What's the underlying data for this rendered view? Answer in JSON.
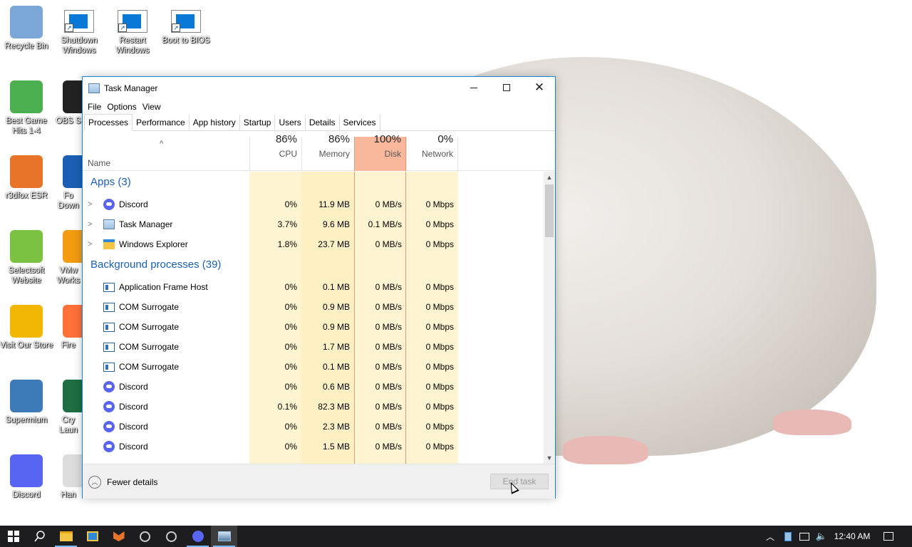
{
  "desktop": {
    "icons_col1": [
      {
        "label": "Recycle Bin",
        "icon": "recycle-bin-icon",
        "color": "#7aa6d8"
      },
      {
        "label": "Best Game Hits 1-4",
        "icon": "dice-icon",
        "color": "#4caf50"
      },
      {
        "label": "r3dfox ESR",
        "icon": "fox-browser-icon",
        "color": "#e8742a"
      },
      {
        "label": "Selectsoft Website",
        "icon": "selectsoft-icon",
        "color": "#7cc242"
      },
      {
        "label": "Visit Our Store",
        "icon": "store-icon",
        "color": "#f2b705"
      },
      {
        "label": "Supermium",
        "icon": "supermium-icon",
        "color": "#3d7ab8"
      },
      {
        "label": "Discord",
        "icon": "discord-icon",
        "color": "#5865f2"
      }
    ],
    "icons_col2_partial": [
      {
        "label": "OBS S",
        "icon": "obs-icon",
        "color": "#222222"
      },
      {
        "label": "Fo Down",
        "icon": "download-icon",
        "color": "#1a5fb4"
      },
      {
        "label": "VMw Works",
        "icon": "vmware-icon",
        "color": "#f39c12"
      },
      {
        "label": "Fire",
        "icon": "firefox-icon",
        "color": "#ff7139"
      },
      {
        "label": "Cry Laun",
        "icon": "launcher-icon",
        "color": "#1f6e43"
      },
      {
        "label": "Han",
        "icon": "document-icon",
        "color": "#dddddd"
      }
    ],
    "icons_top": [
      {
        "label": "Shutdown Windows",
        "icon": "shutdown-shortcut-icon"
      },
      {
        "label": "Restart Windows",
        "icon": "restart-shortcut-icon"
      },
      {
        "label": "Boot to BIOS",
        "icon": "bios-shortcut-icon"
      }
    ]
  },
  "window": {
    "title": "Task Manager",
    "menu": [
      "File",
      "Options",
      "View"
    ],
    "tabs": [
      "Processes",
      "Performance",
      "App history",
      "Startup",
      "Users",
      "Details",
      "Services"
    ],
    "active_tab": "Processes",
    "columns": {
      "name": "Name",
      "cpu": {
        "pct": "86%",
        "label": "CPU"
      },
      "memory": {
        "pct": "86%",
        "label": "Memory"
      },
      "disk": {
        "pct": "100%",
        "label": "Disk"
      },
      "network": {
        "pct": "0%",
        "label": "Network"
      }
    },
    "groups": [
      {
        "title": "Apps (3)",
        "rows": [
          {
            "name": "Discord",
            "icon": "discord",
            "expandable": true,
            "cpu": "0%",
            "memory": "11.9 MB",
            "disk": "0 MB/s",
            "network": "0 Mbps"
          },
          {
            "name": "Task Manager",
            "icon": "tm",
            "expandable": true,
            "cpu": "3.7%",
            "memory": "9.6 MB",
            "disk": "0.1 MB/s",
            "network": "0 Mbps"
          },
          {
            "name": "Windows Explorer",
            "icon": "explorer",
            "expandable": true,
            "cpu": "1.8%",
            "memory": "23.7 MB",
            "disk": "0 MB/s",
            "network": "0 Mbps"
          }
        ]
      },
      {
        "title": "Background processes (39)",
        "rows": [
          {
            "name": "Application Frame Host",
            "icon": "window",
            "expandable": false,
            "cpu": "0%",
            "memory": "0.1 MB",
            "disk": "0 MB/s",
            "network": "0 Mbps"
          },
          {
            "name": "COM Surrogate",
            "icon": "window",
            "expandable": false,
            "cpu": "0%",
            "memory": "0.9 MB",
            "disk": "0 MB/s",
            "network": "0 Mbps"
          },
          {
            "name": "COM Surrogate",
            "icon": "window",
            "expandable": false,
            "cpu": "0%",
            "memory": "0.9 MB",
            "disk": "0 MB/s",
            "network": "0 Mbps"
          },
          {
            "name": "COM Surrogate",
            "icon": "window",
            "expandable": false,
            "cpu": "0%",
            "memory": "1.7 MB",
            "disk": "0 MB/s",
            "network": "0 Mbps"
          },
          {
            "name": "COM Surrogate",
            "icon": "window",
            "expandable": false,
            "cpu": "0%",
            "memory": "0.1 MB",
            "disk": "0 MB/s",
            "network": "0 Mbps"
          },
          {
            "name": "Discord",
            "icon": "discord",
            "expandable": false,
            "cpu": "0%",
            "memory": "0.6 MB",
            "disk": "0 MB/s",
            "network": "0 Mbps"
          },
          {
            "name": "Discord",
            "icon": "discord",
            "expandable": false,
            "cpu": "0.1%",
            "memory": "82.3 MB",
            "disk": "0 MB/s",
            "network": "0 Mbps"
          },
          {
            "name": "Discord",
            "icon": "discord",
            "expandable": false,
            "cpu": "0%",
            "memory": "2.3 MB",
            "disk": "0 MB/s",
            "network": "0 Mbps"
          },
          {
            "name": "Discord",
            "icon": "discord",
            "expandable": false,
            "cpu": "0%",
            "memory": "1.5 MB",
            "disk": "0 MB/s",
            "network": "0 Mbps"
          }
        ]
      }
    ],
    "footer": {
      "fewer_details": "Fewer details",
      "end_task": "End task"
    }
  },
  "taskbar": {
    "clock": "12:40 AM",
    "apps": [
      "start-icon",
      "search-icon",
      "file-explorer-icon",
      "app-window-icon",
      "fox-browser-icon",
      "obs-icon",
      "obs-alt-icon",
      "discord-icon",
      "task-manager-icon"
    ]
  },
  "colors": {
    "accent": "#1883d7",
    "heat_light": "#fff4d1",
    "heat_mid": "#ffe8a6",
    "disk_header": "#f9b89c",
    "group_title": "#1a5fb4"
  }
}
